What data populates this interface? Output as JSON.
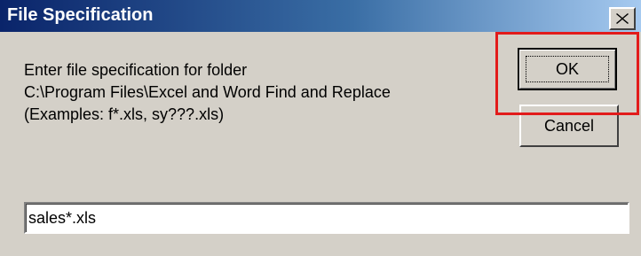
{
  "window": {
    "title": "File Specification",
    "close_icon": "close-icon"
  },
  "message": {
    "line1": "Enter file specification for folder",
    "line2": "C:\\Program Files\\Excel and Word Find and Replace",
    "line3": "(Examples: f*.xls, sy???.xls)"
  },
  "buttons": {
    "ok_label": "OK",
    "cancel_label": "Cancel"
  },
  "input": {
    "value": "sales*.xls"
  },
  "colors": {
    "titlebar_start": "#0a246a",
    "titlebar_end": "#a6caf0",
    "dialog_background": "#d4d0c8",
    "highlight": "#e21b1b"
  }
}
